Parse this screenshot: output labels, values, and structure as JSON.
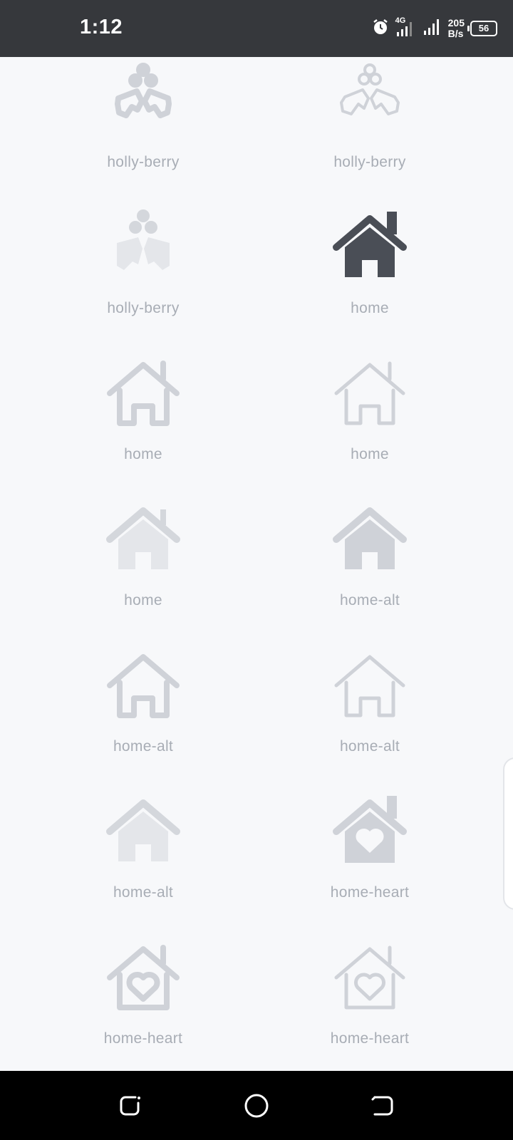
{
  "status_bar": {
    "time": "1:12",
    "network_type": "4G",
    "net_speed_value": "205",
    "net_speed_unit": "B/s",
    "battery": "56"
  },
  "icons": [
    {
      "label": "holly-berry",
      "style": "solid",
      "tone": "gray",
      "icon": "holly-berry-icon"
    },
    {
      "label": "holly-berry",
      "style": "thin",
      "tone": "gray",
      "icon": "holly-berry-icon"
    },
    {
      "label": "holly-berry",
      "style": "duotone",
      "tone": "light",
      "icon": "holly-berry-icon"
    },
    {
      "label": "home",
      "style": "solid",
      "tone": "dark",
      "icon": "home-icon"
    },
    {
      "label": "home",
      "style": "outline",
      "tone": "gray",
      "icon": "home-icon"
    },
    {
      "label": "home",
      "style": "thin",
      "tone": "gray",
      "icon": "home-icon"
    },
    {
      "label": "home",
      "style": "duotone",
      "tone": "light",
      "icon": "home-icon"
    },
    {
      "label": "home-alt",
      "style": "solid",
      "tone": "gray",
      "icon": "home-alt-icon"
    },
    {
      "label": "home-alt",
      "style": "outline",
      "tone": "gray",
      "icon": "home-alt-icon"
    },
    {
      "label": "home-alt",
      "style": "thin",
      "tone": "gray",
      "icon": "home-alt-icon"
    },
    {
      "label": "home-alt",
      "style": "duotone",
      "tone": "light",
      "icon": "home-alt-icon"
    },
    {
      "label": "home-heart",
      "style": "solid",
      "tone": "gray",
      "icon": "home-heart-icon"
    },
    {
      "label": "home-heart",
      "style": "outline",
      "tone": "gray",
      "icon": "home-heart-icon"
    },
    {
      "label": "home-heart",
      "style": "thin",
      "tone": "gray",
      "icon": "home-heart-icon"
    }
  ],
  "colors": {
    "background": "#f7f8fa",
    "icon_gray": "#cfd2d8",
    "icon_light": "#e4e6ea",
    "icon_dark": "#4a4e56",
    "label": "#a8adb5"
  }
}
